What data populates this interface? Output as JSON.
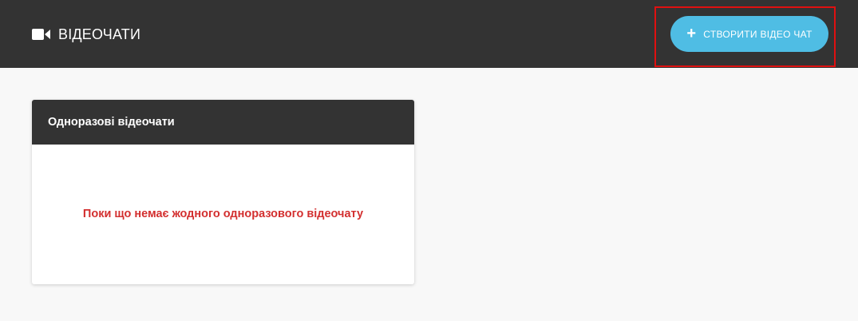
{
  "header": {
    "title": "ВІДЕОЧАТИ",
    "title_icon": "video-camera-icon",
    "create_button": {
      "label": "СТВОРИТИ ВІДЕО ЧАТ",
      "icon": "plus-icon",
      "color": "#4fbde4"
    },
    "background": "#333333"
  },
  "card": {
    "title": "Одноразові відеочати",
    "empty_message": "Поки що немає жодного одноразового відеочату",
    "empty_color": "#d32f2f"
  },
  "highlight_color": "#e01010"
}
